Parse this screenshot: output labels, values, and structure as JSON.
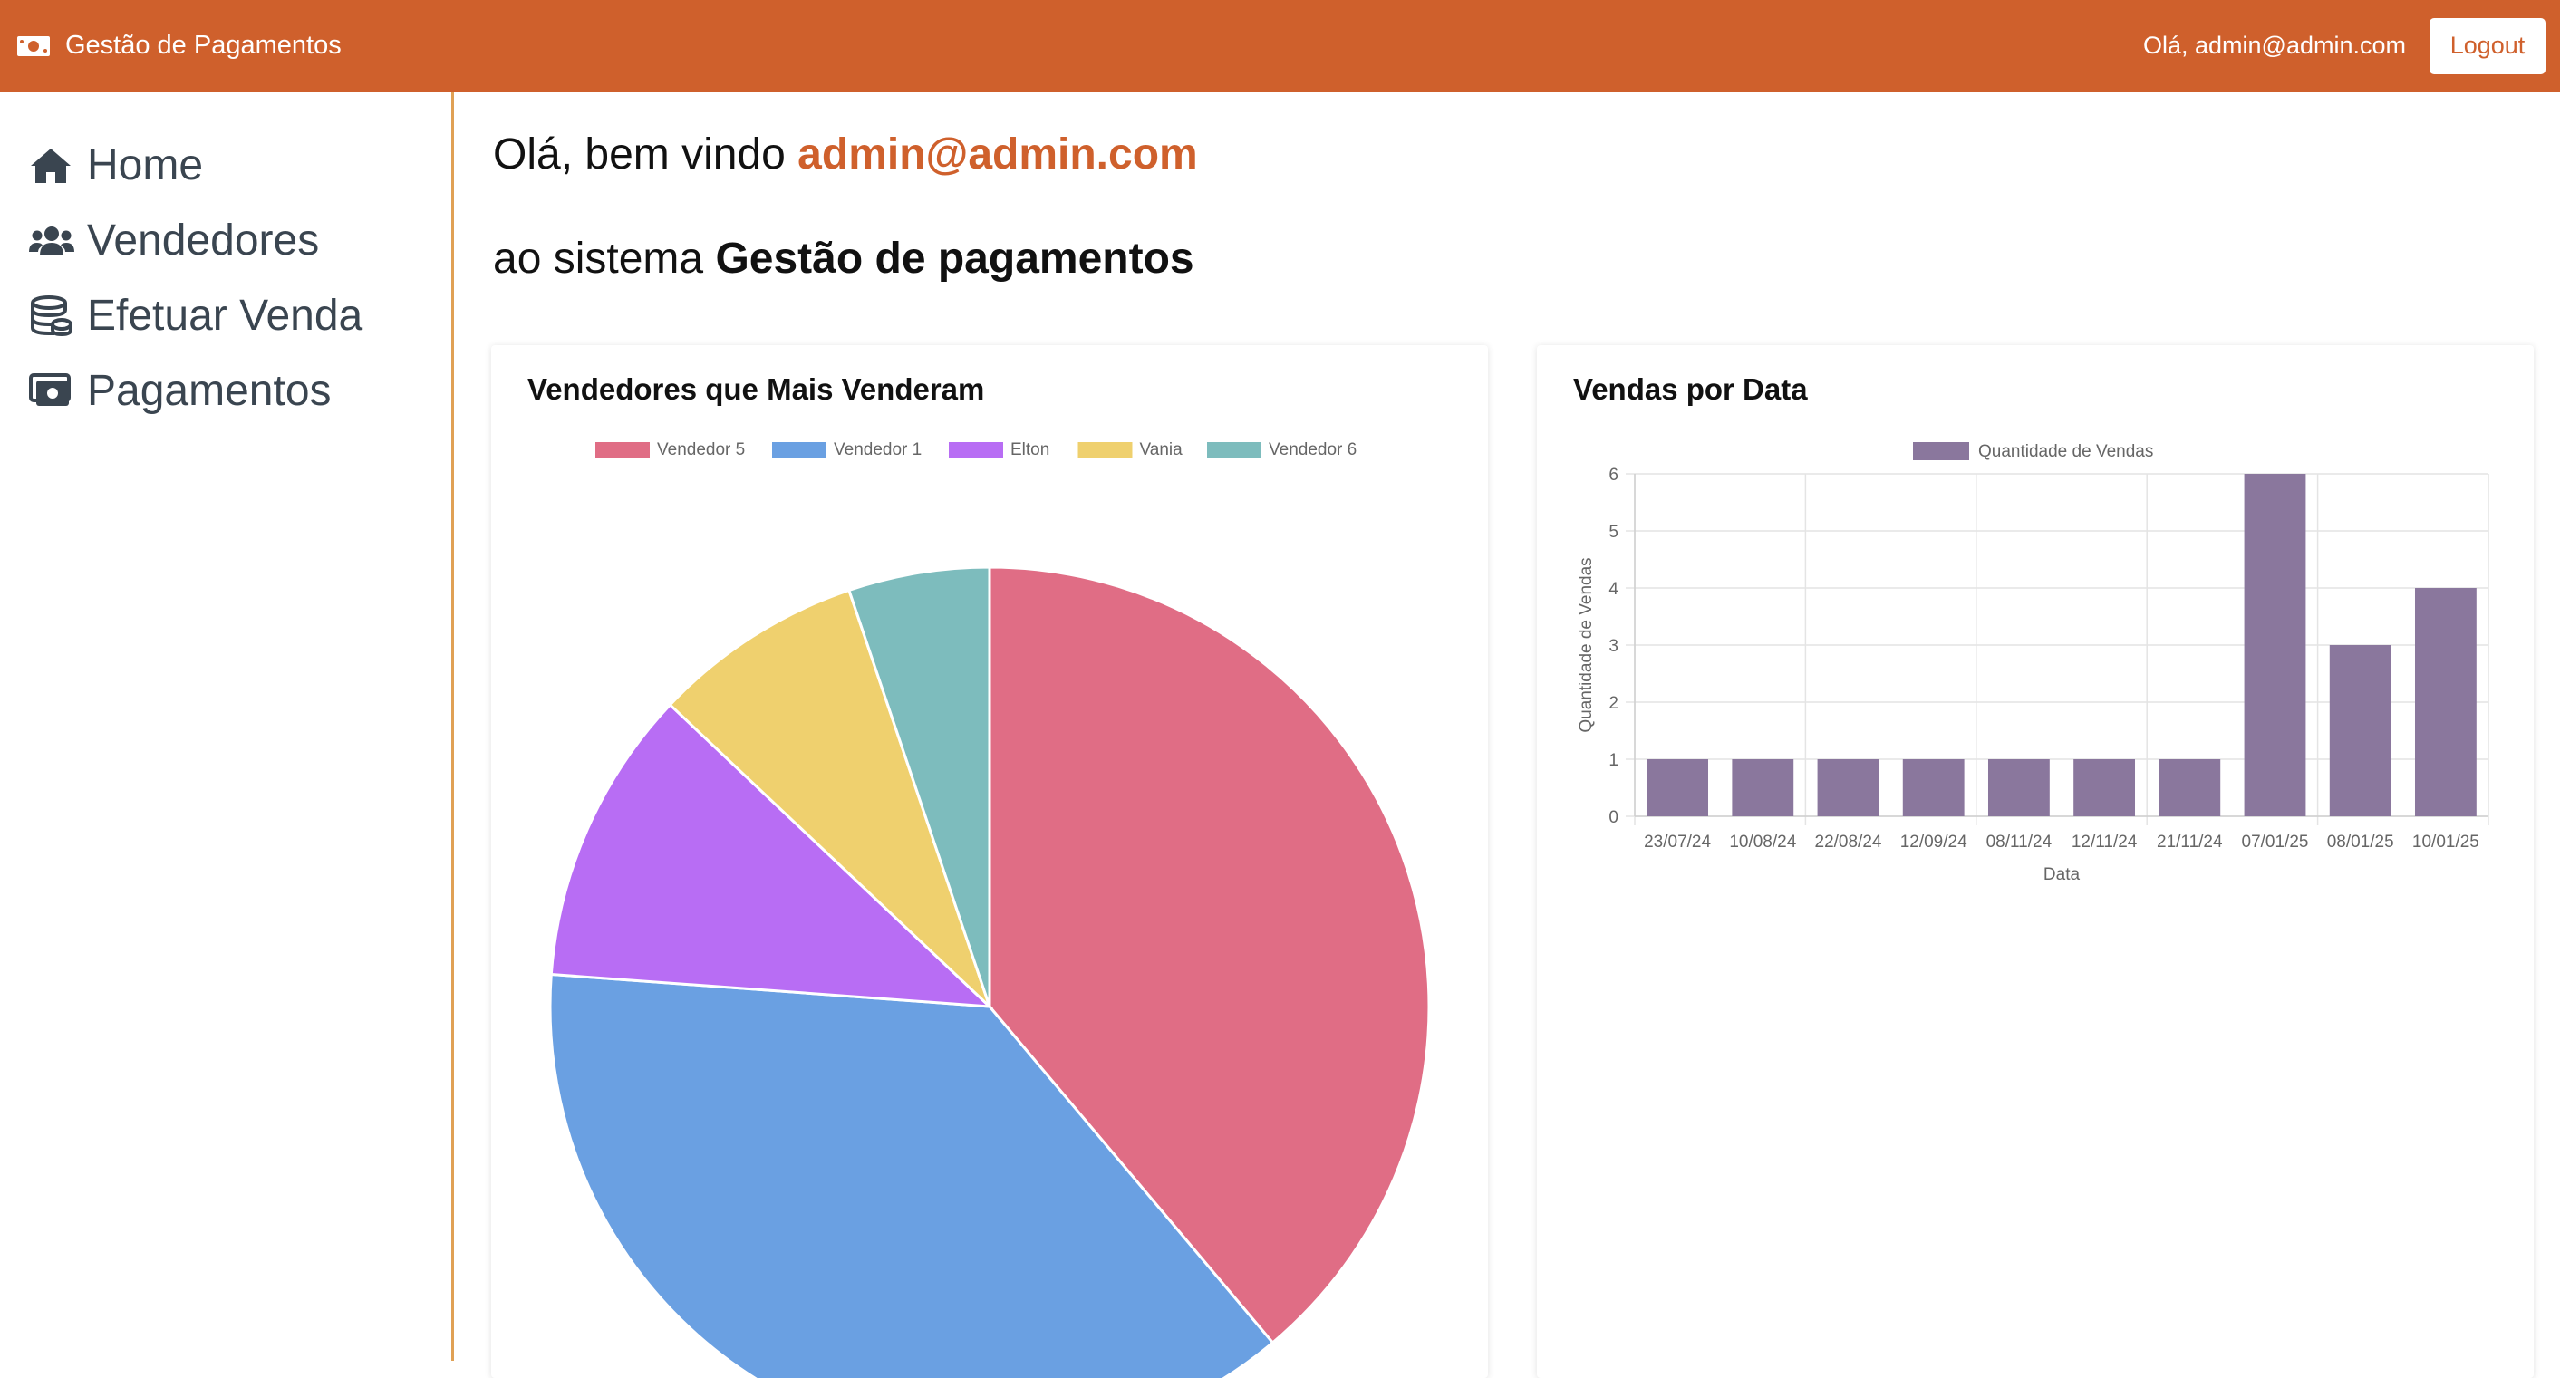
{
  "header": {
    "brand": "Gestão de Pagamentos",
    "greeting": "Olá, admin@admin.com",
    "logout_label": "Logout"
  },
  "sidebar": {
    "items": [
      {
        "label": "Home",
        "icon": "home-icon"
      },
      {
        "label": "Vendedores",
        "icon": "users-icon"
      },
      {
        "label": "Efetuar Venda",
        "icon": "coins-icon"
      },
      {
        "label": "Pagamentos",
        "icon": "money-icon"
      }
    ]
  },
  "welcome": {
    "prefix": "Olá, bem vindo ",
    "user": "admin@admin.com",
    "system_prefix": "ao sistema ",
    "system_name": "Gestão de pagamentos"
  },
  "colors": {
    "brand": "#cf602c",
    "sidebar_border": "#e0a155",
    "bar": "#8a779d"
  },
  "chart_data": [
    {
      "type": "pie",
      "title": "Vendedores que Mais Venderam",
      "legend_position": "top",
      "labels": [
        "Vendedor 5",
        "Vendedor 1",
        "Elton",
        "Vania",
        "Vendedor 6"
      ],
      "values": [
        7.5,
        7.2,
        2.1,
        1.5,
        1.0
      ],
      "colors": [
        "#e06d85",
        "#6aa0e2",
        "#b86df4",
        "#efd06e",
        "#7dbcbd"
      ]
    },
    {
      "type": "bar",
      "title": "Vendas por Data",
      "legend_position": "top",
      "categories": [
        "23/07/24",
        "10/08/24",
        "22/08/24",
        "12/09/24",
        "08/11/24",
        "12/11/24",
        "21/11/24",
        "07/01/25",
        "08/01/25",
        "10/01/25"
      ],
      "series": [
        {
          "name": "Quantidade de Vendas",
          "values": [
            1,
            1,
            1,
            1,
            1,
            1,
            1,
            6,
            3,
            4
          ]
        }
      ],
      "xlabel": "Data",
      "ylabel": "Quantidade de Vendas",
      "ylim": [
        0,
        6
      ],
      "yticks": [
        "0",
        "1",
        "2",
        "3",
        "4",
        "5",
        "6"
      ],
      "grid": true
    }
  ]
}
